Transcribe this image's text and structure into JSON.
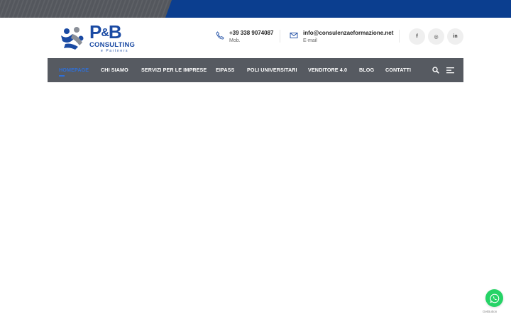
{
  "brand": {
    "logo_main": "P",
    "logo_amp": "&",
    "logo_main_b": "B",
    "logo_sub": "CONSULTING",
    "logo_tagline": "e Partners",
    "colors": {
      "primary": "#1a4aa3",
      "accent": "#2f6fd6",
      "nav_bg": "#565a61",
      "top_strip": "#0b3e8f"
    }
  },
  "contacts": {
    "phone": {
      "value": "+39 338 9074087",
      "label": "Mob.",
      "icon": "phone-icon"
    },
    "email": {
      "value": "info@consulenzaeformazione.net",
      "label": "E-mail",
      "icon": "envelope-icon"
    }
  },
  "social": [
    {
      "glyph": "f",
      "icon": "facebook-icon"
    },
    {
      "glyph": "◎",
      "icon": "instagram-icon"
    },
    {
      "glyph": "in",
      "icon": "linkedin-icon"
    }
  ],
  "nav": {
    "items": [
      {
        "label": "HOMEPAGE",
        "active": true
      },
      {
        "label": "CHI SIAMO"
      },
      {
        "label": "SERVIZI PER LE IMPRESE"
      },
      {
        "label": "EIPASS"
      },
      {
        "label": "POLI UNIVERSITARI"
      },
      {
        "label": "VENDITORE 4.0"
      },
      {
        "label": "BLOG"
      },
      {
        "label": "CONTATTI"
      }
    ]
  },
  "whatsapp": {
    "credit": "GetButton",
    "icon": "whatsapp-icon",
    "color": "#25d366"
  }
}
